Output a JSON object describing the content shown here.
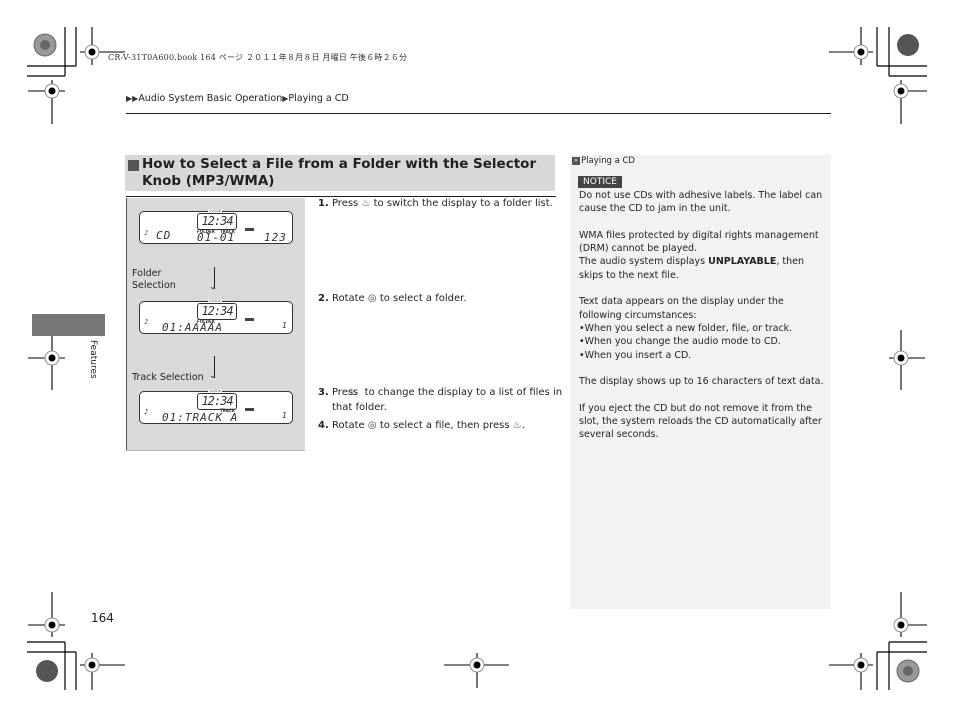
{
  "header": {
    "print_meta": "CR-V-31T0A600.book  164 ページ  ２０１１年８月８日  月曜日  午後６時２６分",
    "breadcrumb": [
      "Audio System Basic Operation",
      "Playing a CD"
    ]
  },
  "section": {
    "title": "How to Select a File from a Folder with the Selector Knob (MP3/WMA)"
  },
  "figure": {
    "displays": [
      {
        "clock_label": "CLOCK",
        "clock": "12:34",
        "left": "CD",
        "label1": "FOLDER",
        "label2": "TRACK",
        "main": "01-01",
        "right": "123"
      },
      {
        "clock_label": "CLOCK",
        "clock": "12:34",
        "label1": "FOLDER",
        "main": "01:AAAAA",
        "right": "1"
      },
      {
        "clock_label": "CLOCK",
        "clock": "12:34",
        "label1": "TRACK",
        "main": "01:TRACK A",
        "right": "1"
      }
    ],
    "labels": {
      "folder_selection": "Folder Selection",
      "track_selection": "Track Selection"
    }
  },
  "steps": [
    {
      "num": "1.",
      "pre": "Press",
      "icon": "selector-knob-press-icon",
      "post": "to switch the display to a folder list."
    },
    {
      "num": "2.",
      "pre": "Rotate",
      "icon": "selector-knob-rotate-icon",
      "post": "to select a folder."
    },
    {
      "num": "3.",
      "pre": "Press",
      "icon": "selector-knob-press-icon",
      "post": "to change the display to a list of files in that folder."
    },
    {
      "num": "4.",
      "pre": "Rotate",
      "icon": "selector-knob-rotate-icon",
      "post": "to select a file, then press",
      "end": "."
    }
  ],
  "sidebar": {
    "ref": "Playing a CD",
    "notice": "NOTICE",
    "p1": "Do not use CDs with adhesive labels. The label can cause the CD to jam in the unit.",
    "p2a": "WMA files protected by digital rights management (DRM) cannot be played.",
    "p2b_pre": "The audio system displays ",
    "p2b_bold": "UNPLAYABLE",
    "p2b_post": ", then skips to the next file.",
    "p3": "Text data appears on the display under the following circumstances:",
    "bullets": [
      "When you select a new folder, file, or track.",
      "When you change the audio mode to CD.",
      "When you insert a CD."
    ],
    "p4": "The display shows up to 16 characters of text data.",
    "p5": "If you eject the CD but do not remove it from the slot, the system reloads the CD automatically after several seconds."
  },
  "side_tab": {
    "label": "Features"
  },
  "page_number": "164"
}
